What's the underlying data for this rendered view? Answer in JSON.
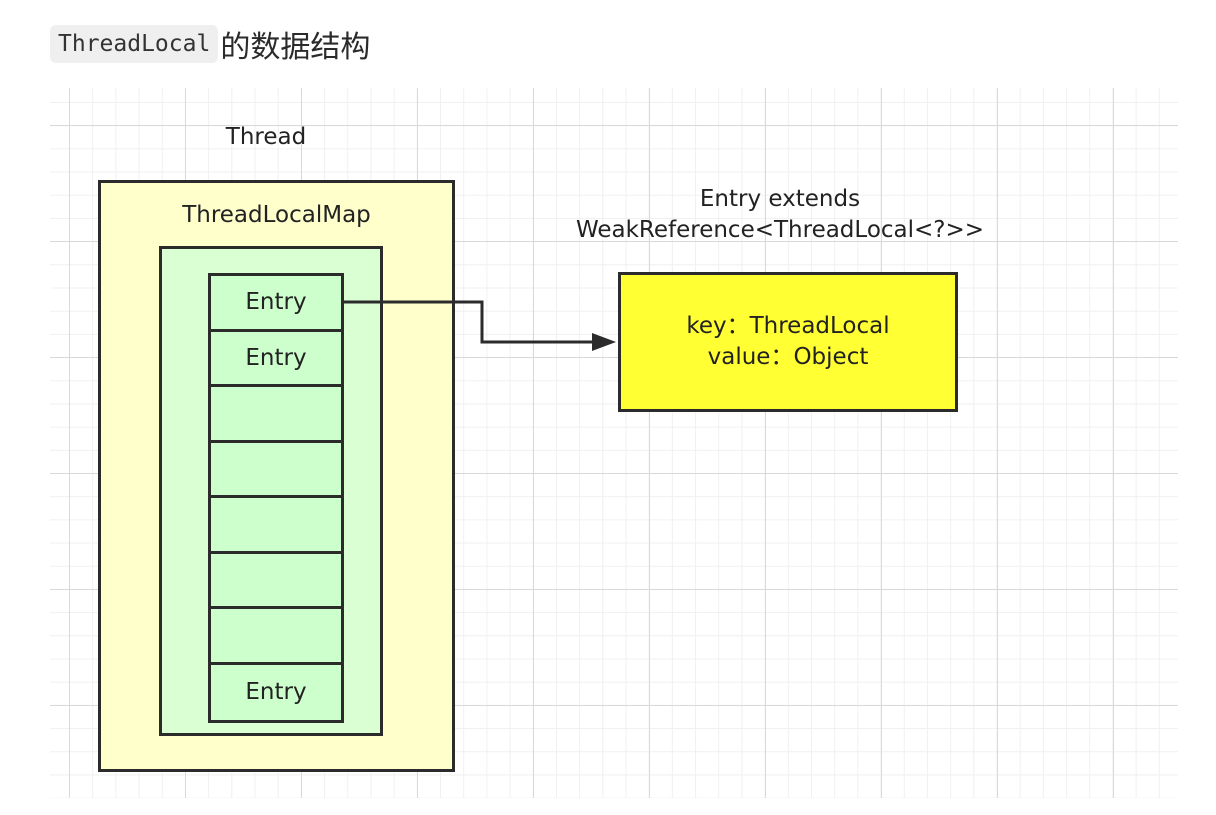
{
  "heading": {
    "code": "ThreadLocal",
    "text": "的数据结构"
  },
  "diagram": {
    "thread_label": "Thread",
    "map_label": "ThreadLocalMap",
    "entries": [
      "Entry",
      "Entry",
      "",
      "",
      "",
      "",
      "",
      "Entry"
    ],
    "entry_class_line1": "Entry extends",
    "entry_class_line2": "WeakReference<ThreadLocal<?>>",
    "entry_key": "key：ThreadLocal",
    "entry_value": "value：Object"
  },
  "colors": {
    "thread_fill": "#ffffcc",
    "map_fill": "#d9ffd2",
    "entry_fill": "#ccffcc",
    "entry_detail_fill": "#ffff33",
    "stroke": "#2b2b2b"
  }
}
